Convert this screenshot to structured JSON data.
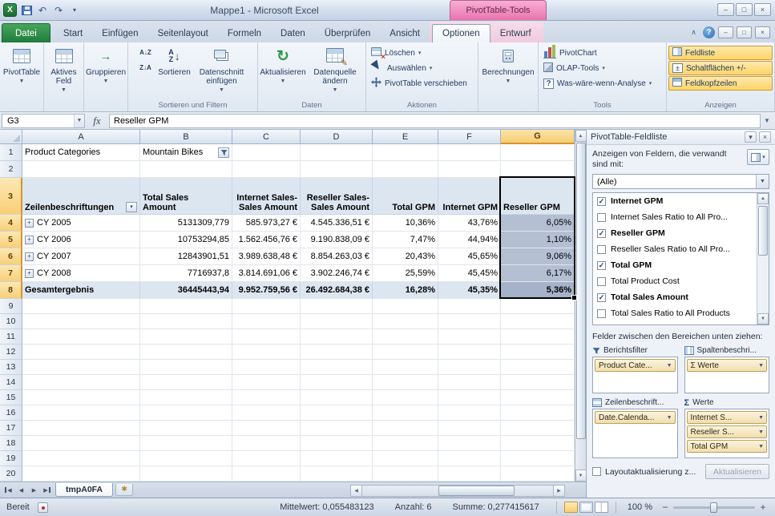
{
  "window": {
    "title": "Mappe1  -  Microsoft Excel",
    "contextual_tool": "PivotTable-Tools"
  },
  "tabs": {
    "file": "Datei",
    "standard": [
      "Start",
      "Einfügen",
      "Seitenlayout",
      "Formeln",
      "Daten",
      "Überprüfen",
      "Ansicht"
    ],
    "contextual": [
      "Optionen",
      "Entwurf"
    ],
    "active": "Optionen"
  },
  "ribbon": {
    "groups": [
      {
        "label": "",
        "buttons": [
          {
            "label": "PivotTable",
            "size": "large",
            "icon": "pivot",
            "dropdown": true
          }
        ]
      },
      {
        "label": "",
        "buttons": [
          {
            "label": "Aktives Feld",
            "size": "large",
            "icon": "field",
            "dropdown": true
          }
        ]
      },
      {
        "label": "",
        "buttons": [
          {
            "label": "Gruppieren",
            "size": "large",
            "icon": "group",
            "dropdown": true
          }
        ]
      },
      {
        "label": "Sortieren und Filtern",
        "buttons": [
          {
            "label": "",
            "size": "stack",
            "icon": "azza",
            "stack_labels": [
              "A↓Z",
              "Z↓A"
            ]
          },
          {
            "label": "Sortieren",
            "size": "large",
            "icon": "sort",
            "dropdown": false
          },
          {
            "label": "Datenschnitt einfügen",
            "size": "large",
            "icon": "slicer",
            "dropdown": true
          }
        ]
      },
      {
        "label": "Daten",
        "buttons": [
          {
            "label": "Aktualisieren",
            "size": "large",
            "icon": "refresh",
            "dropdown": true
          },
          {
            "label": "Datenquelle ändern",
            "size": "large",
            "icon": "datasource",
            "dropdown": true
          }
        ]
      },
      {
        "label": "Aktionen",
        "buttons": [
          {
            "label": "Löschen",
            "size": "small",
            "icon": "clear",
            "dropdown": true
          },
          {
            "label": "Auswählen",
            "size": "small",
            "icon": "select",
            "dropdown": true
          },
          {
            "label": "PivotTable verschieben",
            "size": "small",
            "icon": "move",
            "dropdown": false
          }
        ]
      },
      {
        "label": "",
        "buttons": [
          {
            "label": "Berechnungen",
            "size": "large",
            "icon": "calc",
            "dropdown": true
          }
        ]
      },
      {
        "label": "Tools",
        "buttons": [
          {
            "label": "PivotChart",
            "size": "small",
            "icon": "chart",
            "dropdown": false
          },
          {
            "label": "OLAP-Tools",
            "size": "small",
            "icon": "olap",
            "dropdown": true
          },
          {
            "label": "Was-wäre-wenn-Analyse",
            "size": "small",
            "icon": "whatif",
            "dropdown": true
          }
        ]
      },
      {
        "label": "Anzeigen",
        "buttons": [
          {
            "label": "Feldliste",
            "size": "small",
            "icon": "fieldlist",
            "highlight": true
          },
          {
            "label": "Schaltflächen +/-",
            "size": "small",
            "icon": "plusminus",
            "highlight": true
          },
          {
            "label": "Feldkopfzeilen",
            "size": "small",
            "icon": "headers",
            "highlight": true
          }
        ]
      }
    ]
  },
  "formula_bar": {
    "name_box": "G3",
    "fx": "fx",
    "content": "Reseller GPM"
  },
  "grid": {
    "columns": [
      "A",
      "B",
      "C",
      "D",
      "E",
      "F",
      "G"
    ],
    "rows": [
      "1",
      "2",
      "3",
      "4",
      "5",
      "6",
      "7",
      "8",
      "9",
      "10",
      "11",
      "12",
      "13",
      "14",
      "15",
      "16",
      "17",
      "18",
      "19",
      "20"
    ],
    "selected_column": "G",
    "filter_row": {
      "label": "Product Categories",
      "value": "Mountain Bikes"
    },
    "header_row": [
      "Zeilenbeschriftungen",
      "Total Sales Amount",
      "Internet Sales-Sales Amount",
      "Reseller Sales-Sales Amount",
      "Total GPM",
      "Internet GPM",
      "Reseller GPM"
    ],
    "data_rows": [
      [
        "CY 2005",
        "5131309,779",
        "585.973,27 €",
        "4.545.336,51 €",
        "10,36%",
        "43,76%",
        "6,05%"
      ],
      [
        "CY 2006",
        "10753294,85",
        "1.562.456,76 €",
        "9.190.838,09 €",
        "7,47%",
        "44,94%",
        "1,10%"
      ],
      [
        "CY 2007",
        "12843901,51",
        "3.989.638,48 €",
        "8.854.263,03 €",
        "20,43%",
        "45,65%",
        "9,06%"
      ],
      [
        "CY 2008",
        "7716937,8",
        "3.814.691,06 €",
        "3.902.246,74 €",
        "25,59%",
        "45,45%",
        "6,17%"
      ]
    ],
    "total_row": [
      "Gesamtergebnis",
      "36445443,94",
      "9.952.759,56 €",
      "26.492.684,38 €",
      "16,28%",
      "45,35%",
      "5,36%"
    ]
  },
  "sheet": {
    "tab": "tmpA0FA"
  },
  "field_list": {
    "title": "PivotTable-Feldliste",
    "show_fields_label": "Anzeigen von Feldern, die verwandt sind mit:",
    "source_selected": "(Alle)",
    "fields": [
      {
        "label": "Internet GPM",
        "checked": true
      },
      {
        "label": "Internet Sales Ratio to All Pro...",
        "checked": false
      },
      {
        "label": "Reseller GPM",
        "checked": true
      },
      {
        "label": "Reseller Sales Ratio to All Pro...",
        "checked": false
      },
      {
        "label": "Total GPM",
        "checked": true
      },
      {
        "label": "Total Product Cost",
        "checked": false
      },
      {
        "label": "Total Sales Amount",
        "checked": true
      },
      {
        "label": "Total Sales Ratio to All Products",
        "checked": false
      }
    ],
    "drag_label": "Felder zwischen den Bereichen unten ziehen:",
    "areas": [
      {
        "title": "Berichtsfilter",
        "icon": "filter",
        "items": [
          "Product Cate..."
        ]
      },
      {
        "title": "Spaltenbeschri...",
        "icon": "columns",
        "items": [
          "Σ Werte"
        ]
      },
      {
        "title": "Zeilenbeschrift...",
        "icon": "rows",
        "items": [
          "Date.Calenda..."
        ]
      },
      {
        "title": "Werte",
        "icon": "sigma",
        "items": [
          "Internet S...",
          "Reseller S...",
          "Total GPM"
        ]
      }
    ],
    "defer_label": "Layoutaktualisierung z...",
    "update_button": "Aktualisieren"
  },
  "status": {
    "mode": "Bereit",
    "stats": [
      {
        "label": "Mittelwert:",
        "value": "0,055483123"
      },
      {
        "label": "Anzahl:",
        "value": "6"
      },
      {
        "label": "Summe:",
        "value": "0,277415617"
      }
    ],
    "zoom": "100 %"
  }
}
